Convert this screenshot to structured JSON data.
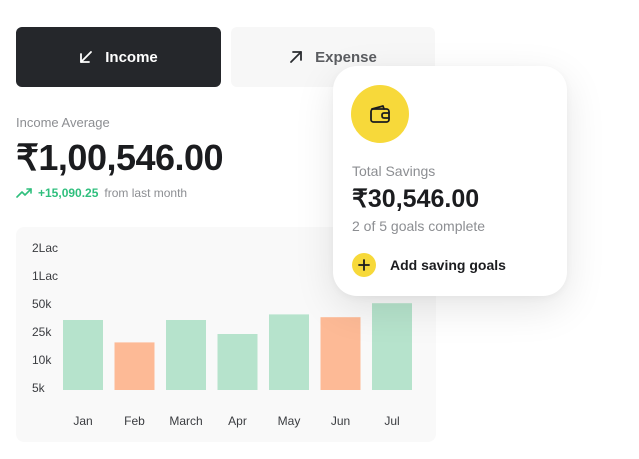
{
  "tabs": {
    "income_label": "Income",
    "expense_label": "Expense"
  },
  "income": {
    "average_label": "Income Average",
    "average_value": "₹1,00,546.00",
    "trend_amount": "+15,090.25",
    "trend_text": "from last month"
  },
  "savings": {
    "label": "Total Savings",
    "value": "₹30,546.00",
    "goals_text": "2 of 5 goals complete",
    "add_label": "Add saving goals"
  },
  "colors": {
    "income_tab": "#25272b",
    "accent_yellow": "#f7d93a",
    "bar_green": "#b6e3cc",
    "bar_orange": "#fdba96",
    "trend_green": "#2fbf7d"
  },
  "icons": {
    "income": "arrow-down-left-icon",
    "expense": "arrow-up-right-icon",
    "trend": "trending-up-icon",
    "wallet": "wallet-icon",
    "add": "plus-icon"
  },
  "chart_data": {
    "type": "bar",
    "categories": [
      "Jan",
      "Feb",
      "March",
      "Apr",
      "May",
      "Jun",
      "Jul"
    ],
    "y_ticks": [
      "2Lac",
      "1Lac",
      "50k",
      "25k",
      "10k",
      "5k"
    ],
    "values": [
      25,
      17,
      25,
      20,
      27,
      26,
      31
    ],
    "value_unit": "k",
    "bar_colors": [
      "#b6e3cc",
      "#fdba96",
      "#b6e3cc",
      "#b6e3cc",
      "#b6e3cc",
      "#fdba96",
      "#b6e3cc"
    ],
    "ylim": [
      0,
      45
    ],
    "grid": false
  }
}
